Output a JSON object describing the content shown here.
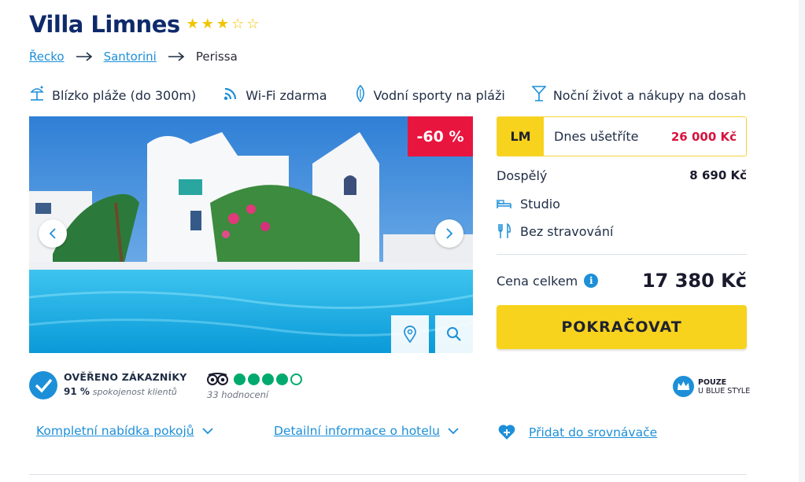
{
  "hotel": {
    "name": "Villa Limnes",
    "rating_stars": 3,
    "max_stars": 5,
    "star_icon": "star-icon",
    "star_color": "#f2c400"
  },
  "breadcrumb": {
    "items": [
      {
        "label": "Řecko",
        "link": true
      },
      {
        "label": "Santorini",
        "link": true
      },
      {
        "label": "Perissa",
        "link": false
      }
    ],
    "separator_icon": "arrow-right-icon"
  },
  "features": [
    {
      "icon": "beach-umbrella-icon",
      "label": "Blízko pláže (do 300m)"
    },
    {
      "icon": "wifi-icon",
      "label": "Wi-Fi zdarma"
    },
    {
      "icon": "surfboard-icon",
      "label": "Vodní sporty na pláži"
    },
    {
      "icon": "cocktail-icon",
      "label": "Noční život a nákupy na dosah"
    }
  ],
  "gallery": {
    "discount_badge": "-60 %",
    "discount_color": "#e8153f",
    "prev_icon": "chevron-left-icon",
    "next_icon": "chevron-right-icon",
    "map_icon": "map-pin-icon",
    "zoom_icon": "search-icon"
  },
  "pricing": {
    "lm_tag": "LM",
    "save_label": "Dnes ušetříte",
    "save_amount": "26 000 Kč",
    "adult_label": "Dospělý",
    "adult_price": "8 690 Kč",
    "room_icon": "bed-icon",
    "room_type": "Studio",
    "board_icon": "fork-knife-icon",
    "board_type": "Bez stravování",
    "total_label": "Cena celkem",
    "info_icon": "info-icon",
    "info_glyph": "i",
    "total_price": "17 380 Kč",
    "continue_label": "POKRAČOVAT",
    "accent_color": "#f7d31e"
  },
  "reviews": {
    "verified_title": "OVĚŘENO ZÁKAZNÍKY",
    "satisfaction_value": "91 %",
    "satisfaction_label": "spokojenost klientů",
    "tripadvisor_icon": "tripadvisor-owl-icon",
    "tripadvisor_rating": 4,
    "tripadvisor_max": 5,
    "tripadvisor_count": "33 hodnocení",
    "tripadvisor_color": "#00aa6c"
  },
  "blue_style": {
    "icon": "crown-icon",
    "line1": "POUZE",
    "line2": "U BLUE STYLE"
  },
  "links": {
    "rooms": "Kompletní nabídka pokojů",
    "hotel_info": "Detailní informace o hotelu",
    "compare": "Přidat do srovnávače",
    "expand_icon": "chevron-down-icon",
    "compare_icon": "heart-plus-icon",
    "link_color": "#1d8fd8"
  }
}
